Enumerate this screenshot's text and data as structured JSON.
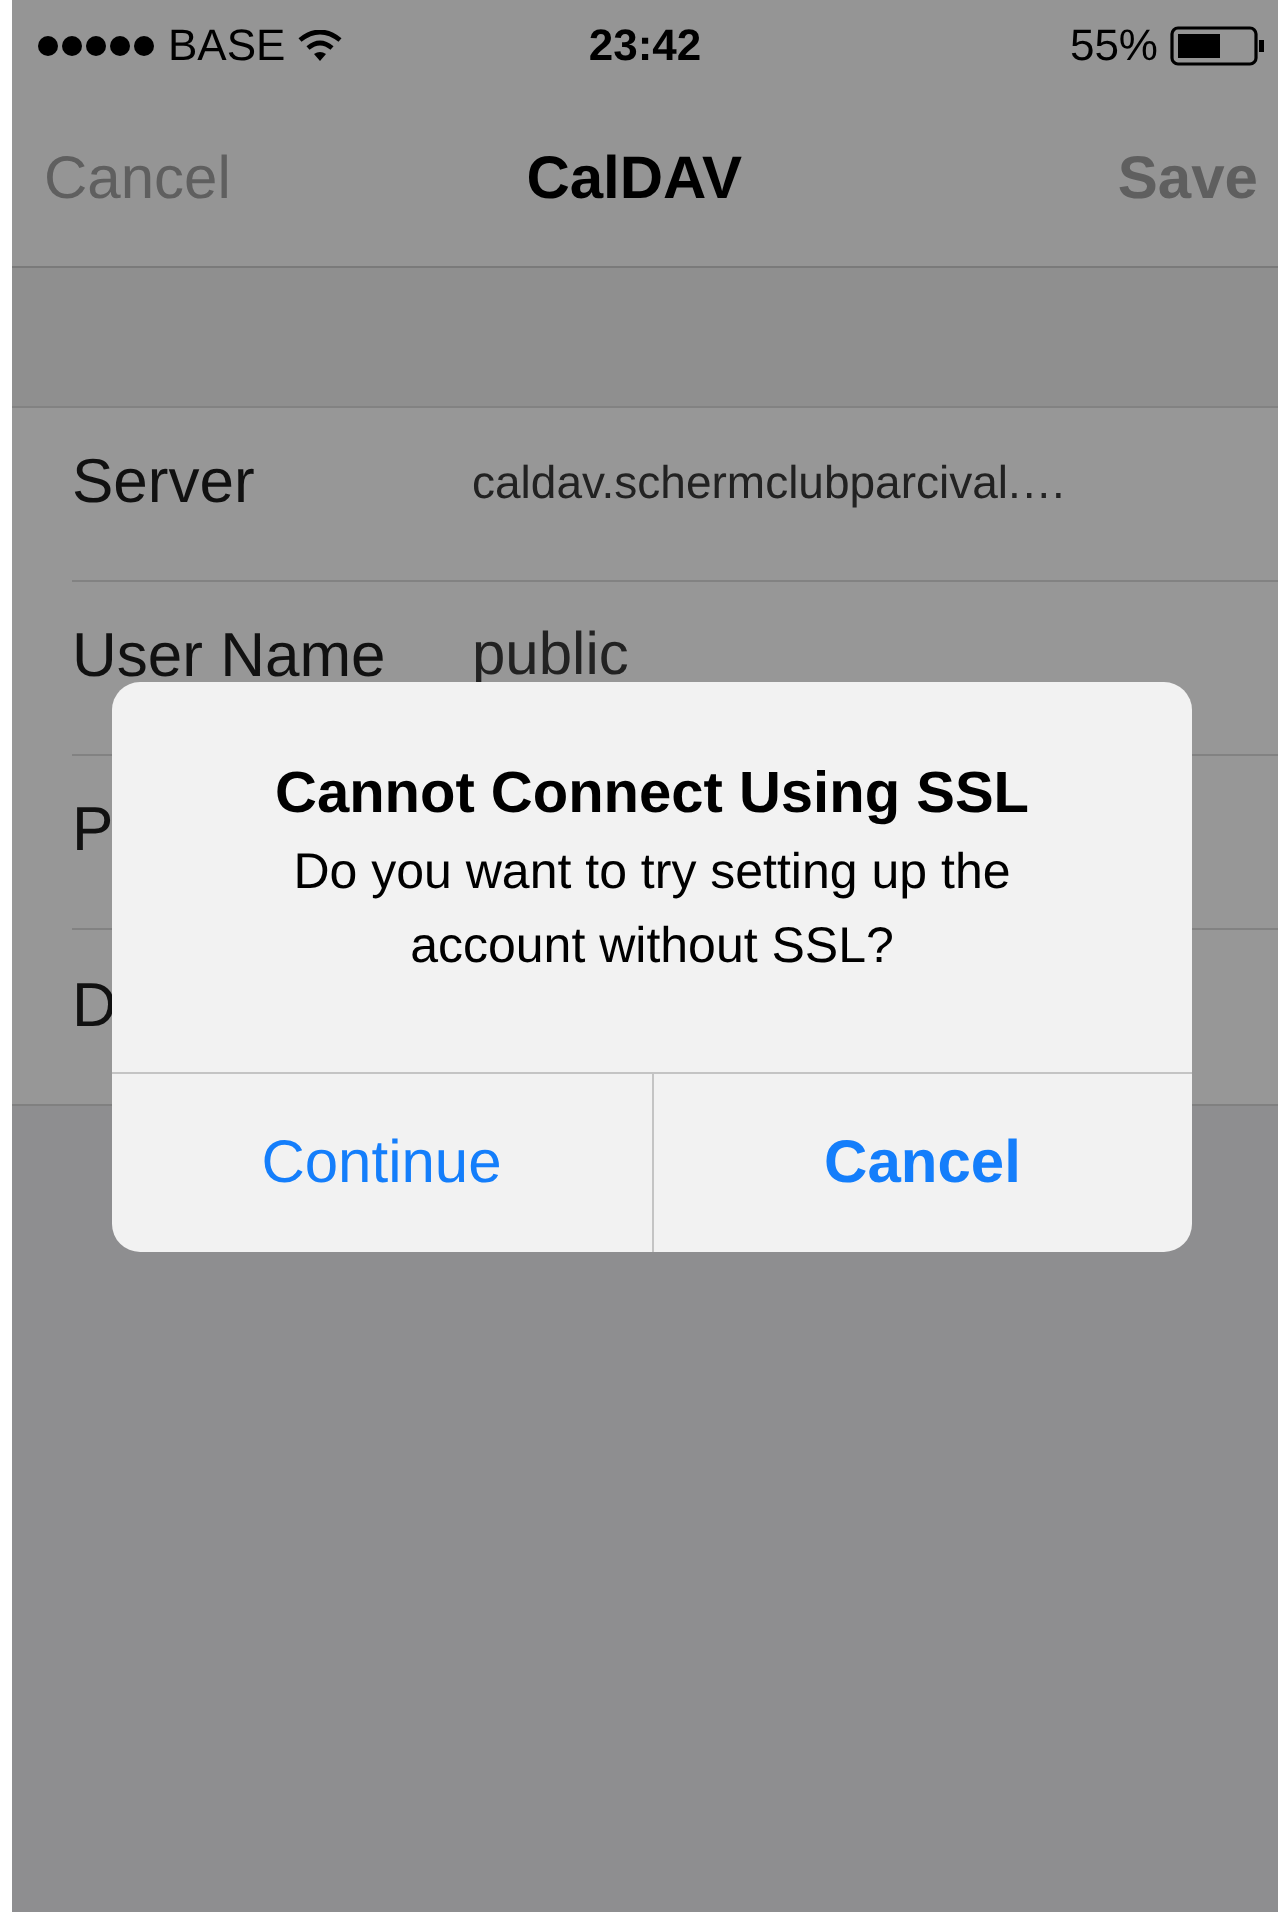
{
  "status_bar": {
    "carrier": "BASE",
    "time": "23:42",
    "battery": "55%"
  },
  "nav_bar": {
    "left": "Cancel",
    "title": "CalDAV",
    "right": "Save"
  },
  "form": {
    "rows": [
      {
        "label": "Server",
        "value": "caldav.schermclubparcival.…"
      },
      {
        "label": "User Name",
        "value": "public"
      },
      {
        "label": "P"
      },
      {
        "label": "D"
      }
    ]
  },
  "alert": {
    "title": "Cannot Connect Using SSL",
    "message": "Do you want to try setting up the account without SSL?",
    "buttons": [
      {
        "label": "Continue",
        "preferred": false
      },
      {
        "label": "Cancel",
        "preferred": true
      }
    ]
  }
}
